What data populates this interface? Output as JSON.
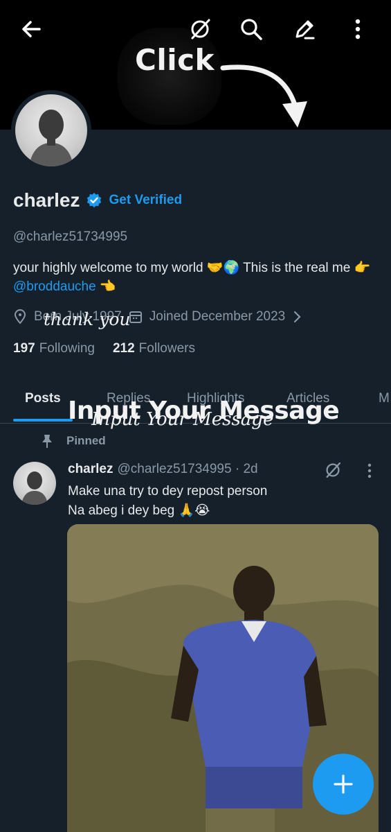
{
  "header": {
    "icons": [
      "back-arrow-icon",
      "grok-icon",
      "search-icon",
      "edit-icon",
      "more-vertical-icon"
    ],
    "overlay_click": "Click"
  },
  "profile": {
    "name": "charlez",
    "get_verified": "Get Verified",
    "handle": "@charlez51734995",
    "bio_prefix": "your highly welcome to my world 🤝🌍 This is the real me 👉 ",
    "bio_mention": "@broddauche",
    "bio_suffix": " 👈",
    "born": "Born July 1997",
    "joined": "Joined December 2023",
    "overlay_thanks": "thank you",
    "following_count": "197",
    "following_label": "Following",
    "followers_count": "212",
    "followers_label": "Followers"
  },
  "tabs": [
    {
      "label": "Posts",
      "active": true
    },
    {
      "label": "Replies",
      "active": false
    },
    {
      "label": "Highlights",
      "active": false
    },
    {
      "label": "Articles",
      "active": false
    },
    {
      "label": "M",
      "active": false
    }
  ],
  "overlay_input": "Input Your Message",
  "overlay_input_2": "Input Your Message",
  "post": {
    "pinned_label": "Pinned",
    "name": "charlez",
    "handle_time": "@charlez51734995 · 2d",
    "line1": "Make una try to dey repost person",
    "line2": "Na abeg i dey beg 🙏😭"
  },
  "colors": {
    "background": "#15202b",
    "accent": "#1d9bf0",
    "secondary_text": "#8b98a5"
  }
}
